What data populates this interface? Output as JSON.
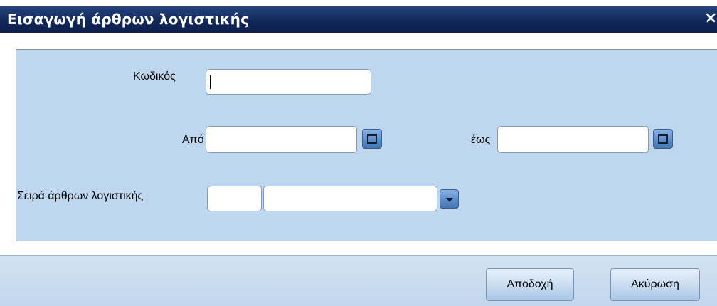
{
  "window": {
    "title": "Εισαγωγή άρθρων λογιστικής",
    "close_label": "×"
  },
  "form": {
    "code": {
      "label": "Κωδικός",
      "value": ""
    },
    "date_from": {
      "label": "Από",
      "value": ""
    },
    "date_to": {
      "label": "έως",
      "value": ""
    },
    "series": {
      "label": "Σειρά άρθρων λογιστικής",
      "code_value": "",
      "name_value": ""
    }
  },
  "buttons": {
    "accept": "Αποδοχή",
    "cancel": "Ακύρωση"
  },
  "icons": {
    "calendar": "calendar-icon",
    "dropdown": "chevron-down-icon",
    "close": "close-icon"
  },
  "colors": {
    "titlebar": "#12285a",
    "panel": "#bed7ef",
    "accent_button": "#5e8fcc"
  }
}
